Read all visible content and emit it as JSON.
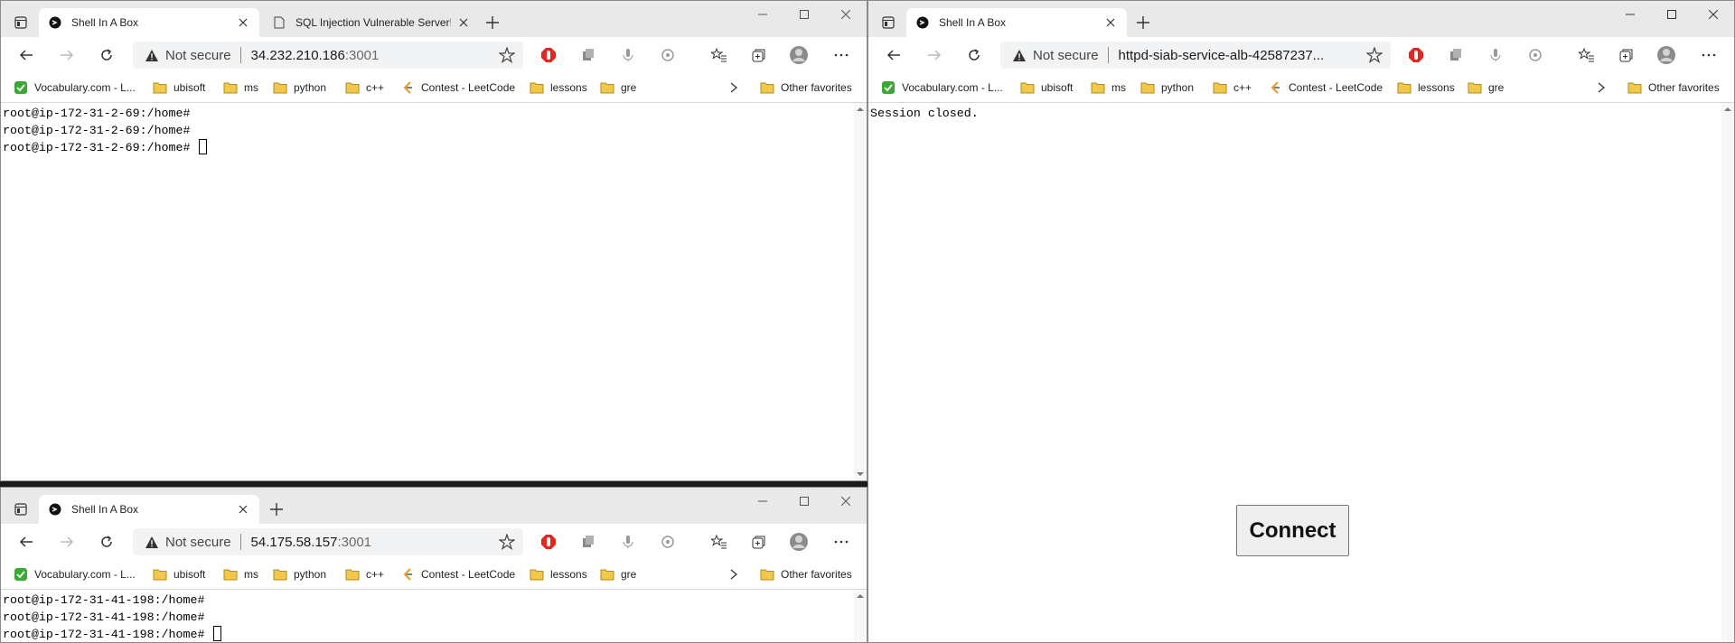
{
  "windows": {
    "top_left": {
      "tabs": [
        {
          "label": "Shell In A Box",
          "active": true
        },
        {
          "label": "SQL Injection Vulnerable Server!",
          "active": false
        }
      ],
      "address": {
        "not_secure": "Not secure",
        "host": "34.232.210.186",
        "port": ":3001"
      },
      "terminal_lines": [
        "root@ip-172-31-2-69:/home#",
        "root@ip-172-31-2-69:/home#",
        "root@ip-172-31-2-69:/home# "
      ]
    },
    "bottom_left": {
      "tabs": [
        {
          "label": "Shell In A Box",
          "active": true
        }
      ],
      "address": {
        "not_secure": "Not secure",
        "host": "54.175.58.157",
        "port": ":3001"
      },
      "terminal_lines": [
        "root@ip-172-31-41-198:/home#",
        "root@ip-172-31-41-198:/home#",
        "root@ip-172-31-41-198:/home# "
      ]
    },
    "right": {
      "tabs": [
        {
          "label": "Shell In A Box",
          "active": true
        }
      ],
      "address": {
        "not_secure": "Not secure",
        "host": "httpd-siab-service-alb-42587237...",
        "port": ""
      },
      "session_text": "Session closed.",
      "connect_label": "Connect"
    }
  },
  "bookmarks": {
    "items": [
      "Vocabulary.com - L...",
      "ubisoft",
      "ms",
      "python",
      "c++",
      "Contest - LeetCode",
      "lessons",
      "gre"
    ],
    "other": "Other favorites"
  },
  "icons": {
    "tab_actions": "tab-actions-icon",
    "favicon": "shellinabox-favicon-icon",
    "new_tab": "plus-icon",
    "back": "back-arrow-icon",
    "forward": "forward-arrow-icon",
    "refresh": "refresh-icon",
    "warning": "warning-icon",
    "favorite": "star-plus-icon",
    "adblock": "adblock-icon",
    "extensions": [
      "ext-copy-icon",
      "ext-mic-icon",
      "ext-shield-icon"
    ],
    "favorites": "favorites-icon",
    "collections": "collections-icon",
    "profile": "profile-icon",
    "more": "more-icon",
    "folder": "folder-icon"
  },
  "colors": {
    "folder": "#f2c84b",
    "adblock": "#e5251f",
    "vocab": "#3aa935",
    "leetcode": "#e79b1e"
  }
}
